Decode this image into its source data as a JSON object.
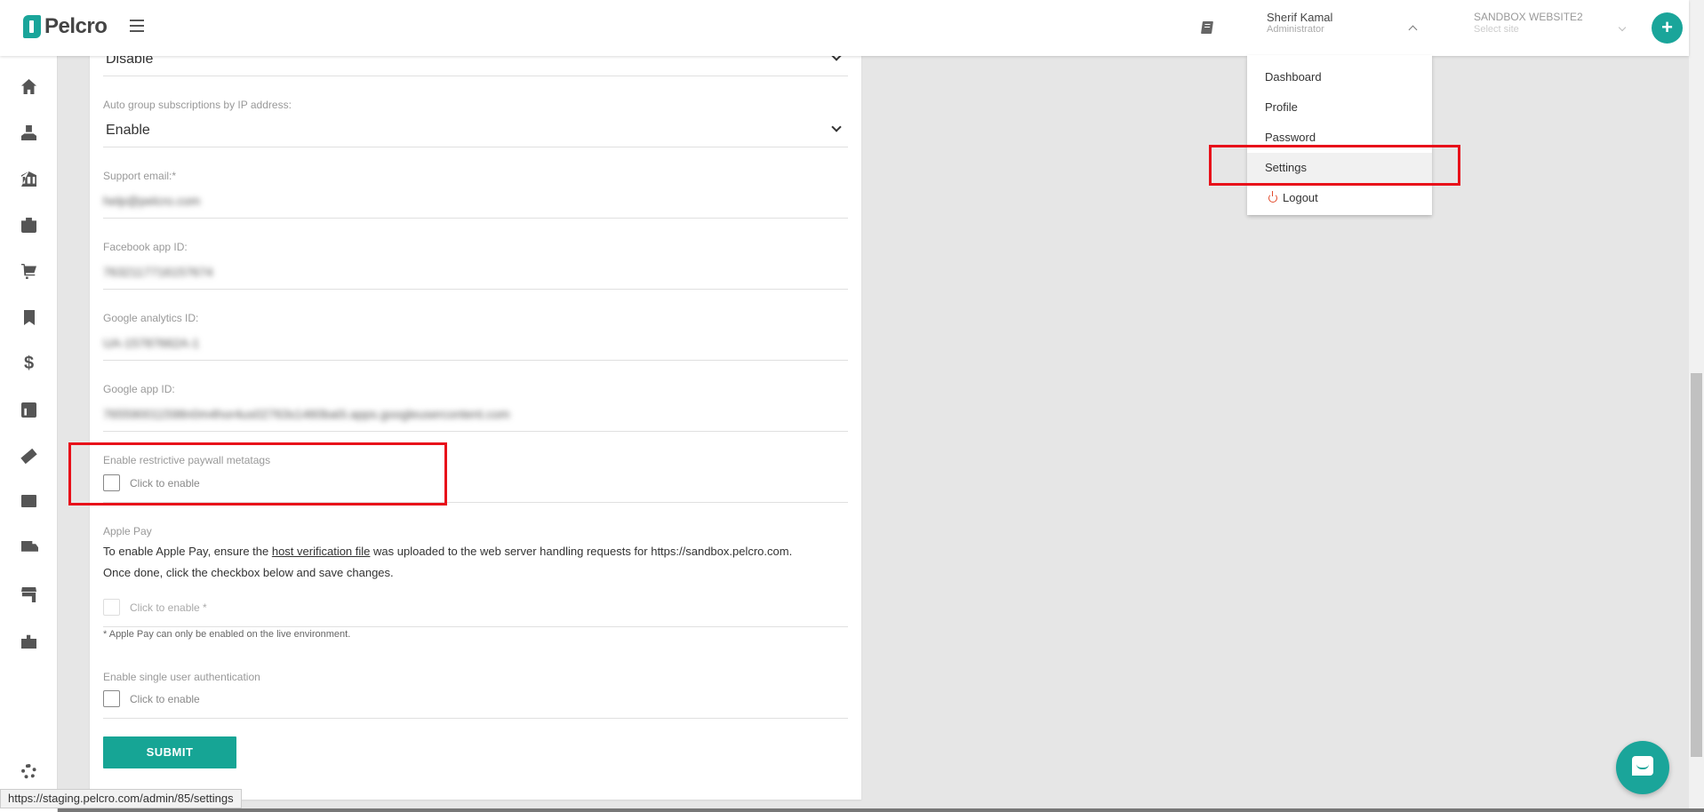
{
  "brand": {
    "name": "Pelcro",
    "accent": "#1aa59a"
  },
  "user": {
    "name": "Sherif Kamal",
    "role": "Administrator"
  },
  "site": {
    "name": "SANDBOX WEBSITE2",
    "placeholder": "Select site"
  },
  "add_button_label": "+",
  "user_menu": [
    {
      "label": "Dashboard"
    },
    {
      "label": "Profile"
    },
    {
      "label": "Password"
    },
    {
      "label": "Settings",
      "active": true
    },
    {
      "label": "Logout",
      "icon": "power-icon"
    }
  ],
  "sidebar_icons": [
    "home-icon",
    "user-icon",
    "bank-icon",
    "briefcase-icon",
    "cart-icon",
    "bookmark-icon",
    "dollar-icon",
    "chart-icon",
    "ticket-icon",
    "mail-icon",
    "truck-icon",
    "store-icon",
    "puzzle-icon",
    "gear-icon"
  ],
  "form": {
    "top_select_value": "Disable",
    "auto_group": {
      "label": "Auto group subscriptions by IP address:",
      "value": "Enable"
    },
    "support_email": {
      "label": "Support email:*",
      "value": "help@pelcro.com"
    },
    "facebook_app_id": {
      "label": "Facebook app ID:",
      "value": "7632117716157674"
    },
    "google_analytics_id": {
      "label": "Google analytics ID:",
      "value": "UA-15787662A-1"
    },
    "google_app_id": {
      "label": "Google app ID:",
      "value": "765590011598n0m4hor4us02763s1460ba0i.apps.googleusercontent.com"
    },
    "paywall_metatags": {
      "label": "Enable restrictive paywall metatags",
      "checkbox_text": "Click to enable"
    },
    "apple_pay": {
      "label": "Apple Pay",
      "text_before_link": "To enable Apple Pay, ensure the ",
      "link_text": "host verification file",
      "text_after_link": " was uploaded to the web server handling requests for https://sandbox.pelcro.com.",
      "line2": "Once done, click the checkbox below and save changes.",
      "checkbox_text": "Click to enable *",
      "note": "* Apple Pay can only be enabled on the live environment."
    },
    "single_user_auth": {
      "label": "Enable single user authentication",
      "checkbox_text": "Click to enable"
    },
    "submit_label": "SUBMIT"
  },
  "status_url": "https://staging.pelcro.com/admin/85/settings"
}
